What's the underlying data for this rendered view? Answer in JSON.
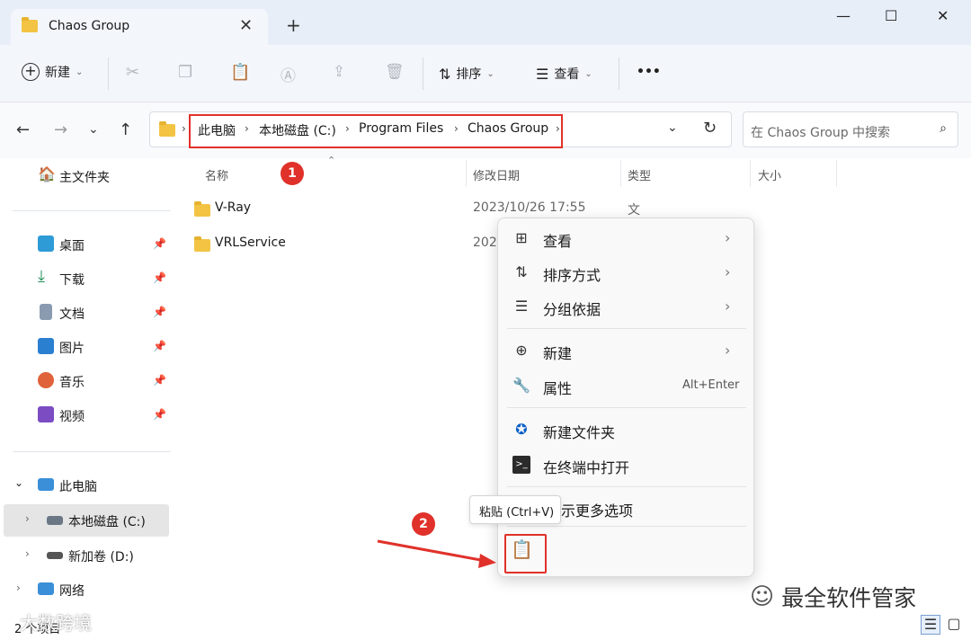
{
  "window": {
    "tab_title": "Chaos Group",
    "new_tab": "+",
    "minimize": "—",
    "maximize": "☐",
    "close": "✕"
  },
  "toolbar": {
    "new_label": "新建",
    "sort_label": "排序",
    "view_label": "查看",
    "more": "•••"
  },
  "breadcrumb": [
    "此电脑",
    "本地磁盘 (C:)",
    "Program Files",
    "Chaos Group"
  ],
  "search": {
    "placeholder": "在 Chaos Group 中搜索"
  },
  "sidebar": {
    "home": "主文件夹",
    "quick": [
      {
        "label": "桌面",
        "icon": "desktop-icon",
        "color": "#2e9bd6"
      },
      {
        "label": "下载",
        "icon": "download-icon",
        "color": "#1f8f5a"
      },
      {
        "label": "文档",
        "icon": "document-icon",
        "color": "#8a9bb0"
      },
      {
        "label": "图片",
        "icon": "pictures-icon",
        "color": "#2b7fd1"
      },
      {
        "label": "音乐",
        "icon": "music-icon",
        "color": "#e0623a"
      },
      {
        "label": "视频",
        "icon": "video-icon",
        "color": "#7b4cc2"
      }
    ],
    "this_pc": "此电脑",
    "drives": [
      "本地磁盘 (C:)",
      "新加卷 (D:)"
    ],
    "network": "网络"
  },
  "columns": {
    "name": "名称",
    "modified": "修改日期",
    "type": "类型",
    "size": "大小"
  },
  "files": [
    {
      "name": "V-Ray",
      "modified": "2023/10/26 17:55",
      "type": "文件夹"
    },
    {
      "name": "VRLService",
      "modified": "202"
    }
  ],
  "context_menu": {
    "items": [
      {
        "label": "查看",
        "icon": "grid-icon"
      },
      {
        "label": "排序方式",
        "icon": "sort-icon"
      },
      {
        "label": "分组依据",
        "icon": "group-icon"
      },
      {
        "label": "新建",
        "icon": "plus-icon"
      },
      {
        "label": "属性",
        "icon": "wrench-icon",
        "shortcut": "Alt+Enter"
      },
      {
        "label": "新建文件夹",
        "icon": "new-folder-icon"
      },
      {
        "label": "在终端中打开",
        "icon": "terminal-icon"
      },
      {
        "label": "示更多选项",
        "icon": "more-options-icon"
      }
    ],
    "tooltip": "粘贴 (Ctrl+V)"
  },
  "annotations": {
    "badge1": "1",
    "badge2": "2"
  },
  "status": {
    "count": "2 个项目"
  },
  "watermark": {
    "text": "最全软件管家",
    "text2": "大数跨境"
  },
  "colors": {
    "highlight": "#e0312a",
    "folder": "#f3c343",
    "accent": "#0067c0"
  }
}
